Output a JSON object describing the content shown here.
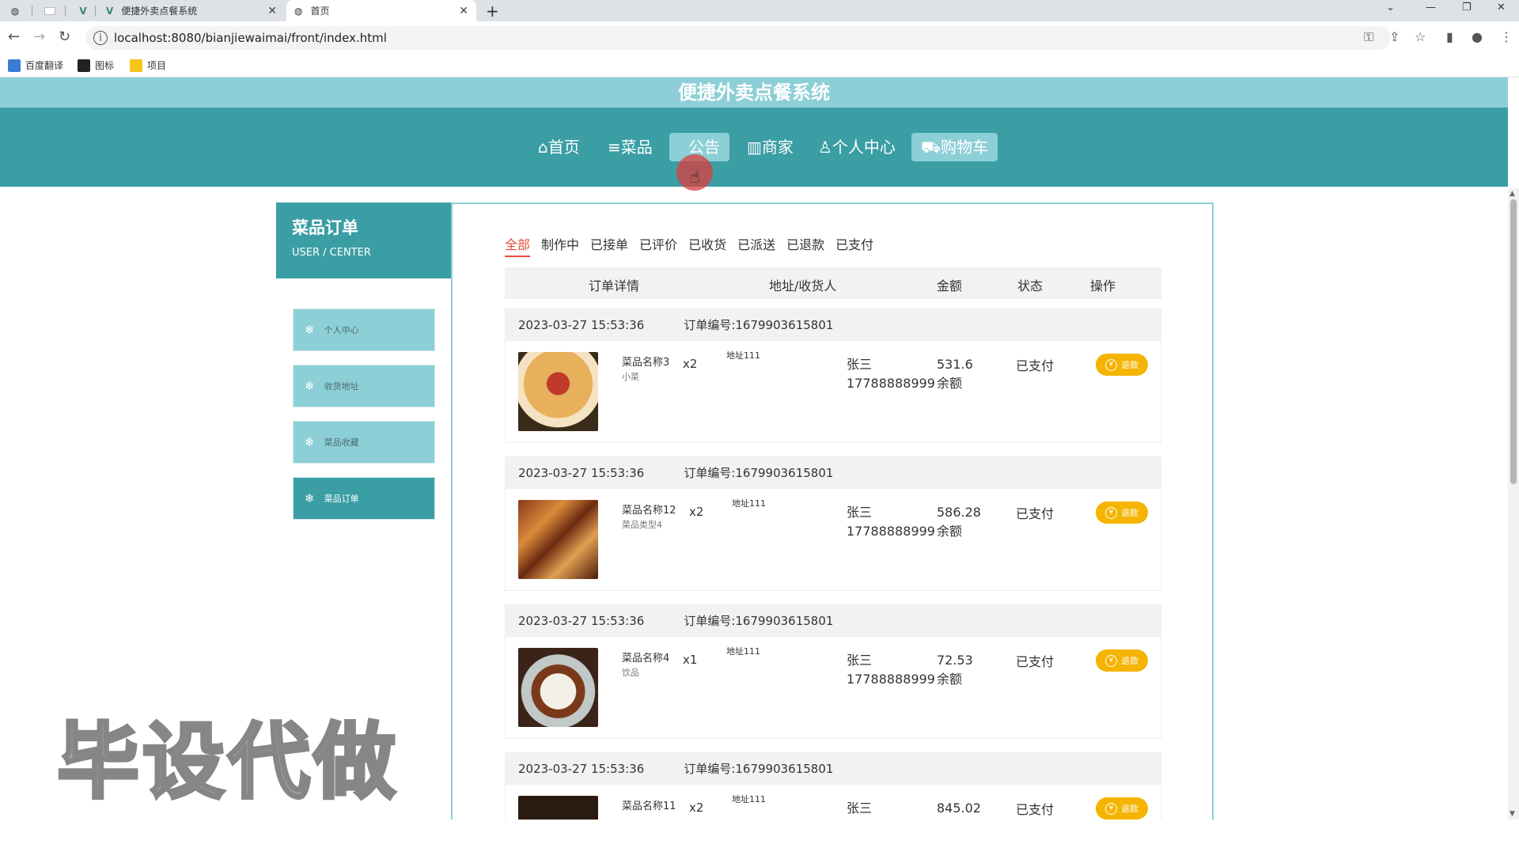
{
  "browser": {
    "tabs": [
      {
        "label": "",
        "icon": "globe-icon"
      },
      {
        "label": "",
        "icon": "blank-page-icon"
      },
      {
        "label": "",
        "icon": "vue-logo-icon"
      },
      {
        "label": "便捷外卖点餐系统",
        "icon": "vue-logo-icon"
      },
      {
        "label": "首页",
        "icon": "globe-icon",
        "active": true
      }
    ],
    "url": "localhost:8080/bianjiewaimai/front/index.html",
    "bookmarks": [
      {
        "label": "百度翻译",
        "color": "#3a7bd5"
      },
      {
        "label": "图标",
        "color": "#222222"
      },
      {
        "label": "项目",
        "color": "#f5c518"
      }
    ]
  },
  "site": {
    "title": "便捷外卖点餐系统",
    "nav": [
      {
        "icon": "⌂",
        "label": "首页"
      },
      {
        "icon": "≡",
        "label": "菜品"
      },
      {
        "icon": "",
        "label": "公告"
      },
      {
        "icon": "▥",
        "label": "商家"
      },
      {
        "icon": "♙",
        "label": "个人中心"
      },
      {
        "icon": "⛟",
        "label": "购物车"
      }
    ],
    "accent": "#3a9ea4",
    "accent_light": "#8dcfd6"
  },
  "sidebar": {
    "title": "菜品订单",
    "subtitle": "USER / CENTER",
    "items": [
      {
        "label": "个人中心"
      },
      {
        "label": "收货地址"
      },
      {
        "label": "菜品收藏"
      },
      {
        "label": "菜品订单",
        "active": true
      }
    ]
  },
  "filters": [
    "全部",
    "制作中",
    "已接单",
    "已评价",
    "已收货",
    "已派送",
    "已退款",
    "已支付"
  ],
  "table_headers": [
    "订单详情",
    "地址/收货人",
    "金额",
    "状态",
    "操作"
  ],
  "orders": [
    {
      "time": "2023-03-27 15:53:36",
      "order_no": "订单编号:1679903615801",
      "name": "菜品名称3",
      "type": "小菜",
      "qty": "x2",
      "address": "地址111",
      "receiver": "张三",
      "phone": "17788888999",
      "amount": "531.6",
      "pay": "余额",
      "status": "已支付",
      "action": "退款"
    },
    {
      "time": "2023-03-27 15:53:36",
      "order_no": "订单编号:1679903615801",
      "name": "菜品名称12",
      "type": "菜品类型4",
      "qty": "x2",
      "address": "地址111",
      "receiver": "张三",
      "phone": "17788888999",
      "amount": "586.28",
      "pay": "余额",
      "status": "已支付",
      "action": "退款"
    },
    {
      "time": "2023-03-27 15:53:36",
      "order_no": "订单编号:1679903615801",
      "name": "菜品名称4",
      "type": "饮品",
      "qty": "x1",
      "address": "地址111",
      "receiver": "张三",
      "phone": "17788888999",
      "amount": "72.53",
      "pay": "余额",
      "status": "已支付",
      "action": "退款"
    },
    {
      "time": "2023-03-27 15:53:36",
      "order_no": "订单编号:1679903615801",
      "name": "菜品名称11",
      "type": "",
      "qty": "x2",
      "address": "地址111",
      "receiver": "张三",
      "phone": "",
      "amount": "845.02",
      "pay": "",
      "status": "已支付",
      "action": "退款"
    }
  ],
  "watermark": "毕设代做"
}
